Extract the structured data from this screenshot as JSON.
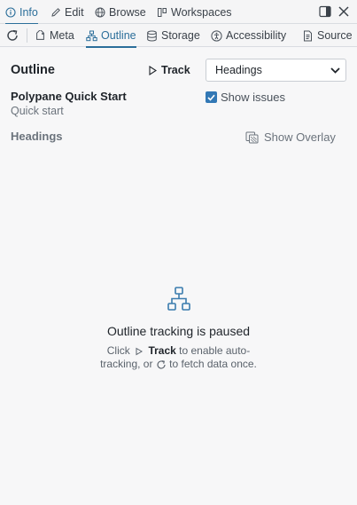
{
  "top_tabs": [
    {
      "label": "Info",
      "icon": "info-icon",
      "active": true
    },
    {
      "label": "Edit",
      "icon": "pencil-icon"
    },
    {
      "label": "Browse",
      "icon": "globe-icon"
    },
    {
      "label": "Workspaces",
      "icon": "workspaces-icon"
    }
  ],
  "sub_tabs": [
    {
      "label": "Meta",
      "icon": "tag-icon"
    },
    {
      "label": "Outline",
      "icon": "outline-icon",
      "active": true
    },
    {
      "label": "Storage",
      "icon": "database-icon"
    },
    {
      "label": "Accessibility",
      "icon": "accessibility-icon"
    },
    {
      "label": "Source",
      "icon": "document-icon"
    }
  ],
  "panel": {
    "title": "Outline",
    "track_label": "Track",
    "select_value": "Headings",
    "page_name": "Polypane Quick Start",
    "page_subtitle": "Quick start",
    "show_issues_label": "Show issues",
    "show_issues_checked": true,
    "section_label": "Headings",
    "show_overlay_label": "Show Overlay"
  },
  "empty_state": {
    "title": "Outline tracking is paused",
    "desc_click": "Click",
    "desc_track": "Track",
    "desc_rest1": "to enable auto-tracking, or",
    "desc_rest2": "to fetch data once."
  },
  "colors": {
    "accent": "#2b6e9a",
    "checkbox": "#3278b5",
    "icon_blue": "#3a7cae"
  }
}
